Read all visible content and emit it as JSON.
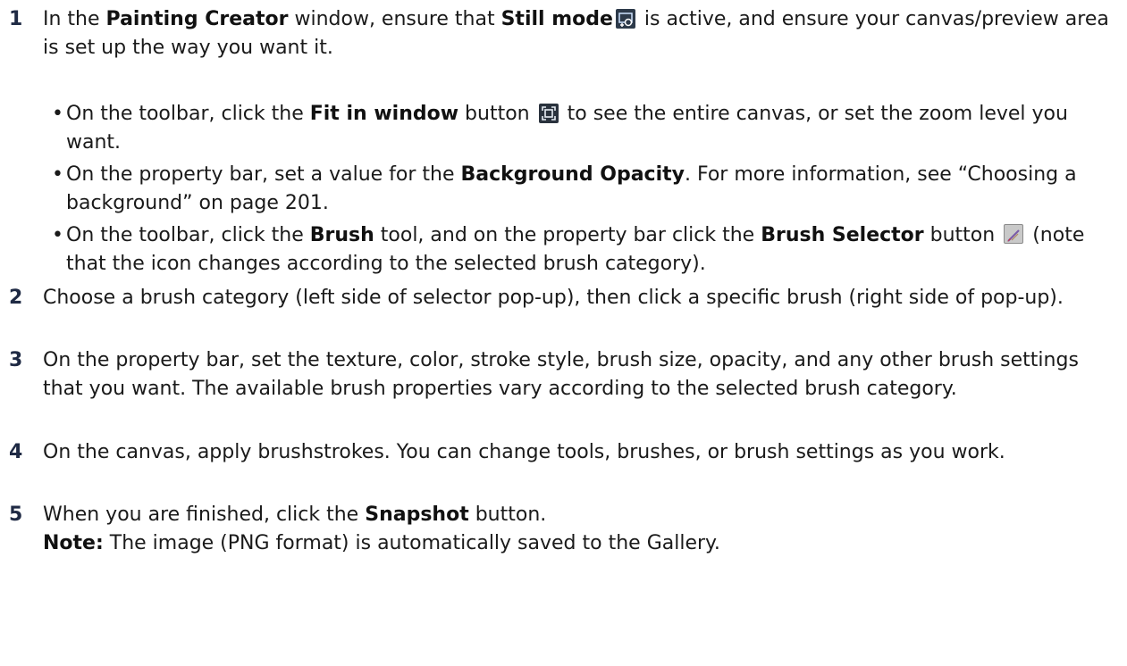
{
  "steps": [
    {
      "num": "1",
      "t1": "In the ",
      "b1": "Painting Creator",
      "t2": " window, ensure that ",
      "b2": "Still mode",
      "t3": " is active, and ensure your canvas/preview area is set up the way you want it.",
      "icon": "still-mode-icon"
    },
    {
      "num": "2",
      "text": "Choose a brush category (left side of selector pop-up), then click a specific brush (right side of pop-up)."
    },
    {
      "num": "3",
      "text": "On the property bar, set the texture, color, stroke style, brush size, opacity, and any other brush settings that you want. The available brush properties vary according to the selected brush category."
    },
    {
      "num": "4",
      "text": "On the canvas, apply brushstrokes. You can change tools, brushes, or brush settings as you work."
    },
    {
      "num": "5",
      "t1": "When you are finished, click the ",
      "b1": "Snapshot",
      "t2": " button.",
      "note_label": "Note:",
      "note_text": "  The image (PNG format) is automatically saved to the Gallery."
    }
  ],
  "bullets": [
    {
      "t1": "On the toolbar, click the ",
      "b1": "Fit in window",
      "t2": " button ",
      "t3": " to see the entire canvas, or set the zoom level you want.",
      "icon": "fit-in-window-icon"
    },
    {
      "t1": "On the property bar, set a value for the ",
      "b1": "Background Opacity",
      "t2": ". For more information, see “Choosing a background” on page 201."
    },
    {
      "t1": "On the toolbar, click the ",
      "b1": "Brush",
      "t2": " tool, and on the property bar click the ",
      "b2": "Brush Selector",
      "t3": " button ",
      "t4": " (note that the icon changes according to the selected brush category).",
      "icon": "brush-selector-icon"
    }
  ],
  "bullet_char": "•"
}
